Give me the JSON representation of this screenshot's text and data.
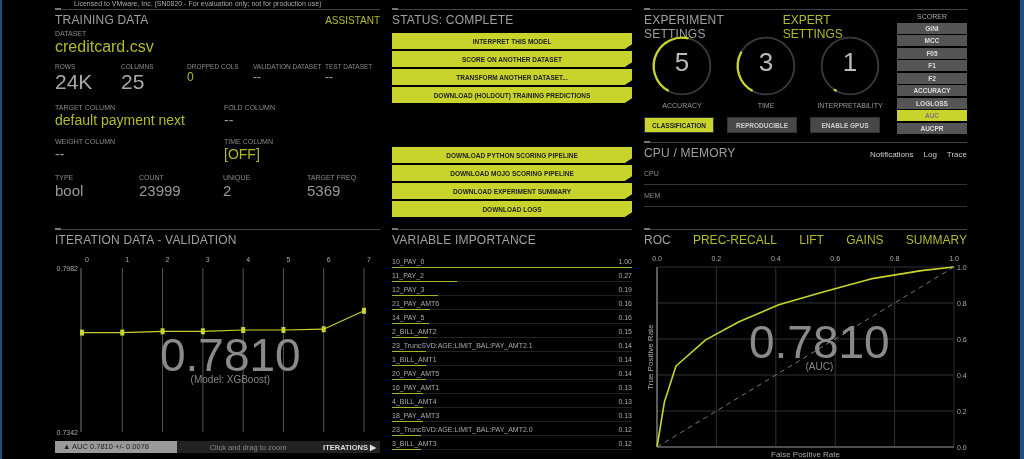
{
  "license_notice": "Licensed to VMware, Inc. (SN0820 - For evaluation only; not for production use)",
  "training_data": {
    "title": "TRAINING DATA",
    "assistant": "ASSISTANT",
    "dataset": {
      "label": "DATASET",
      "value": "creditcard.csv"
    },
    "stats": [
      {
        "label": "ROWS",
        "value": "24K",
        "highlight": false
      },
      {
        "label": "COLUMNS",
        "value": "25",
        "highlight": false
      },
      {
        "label": "DROPPED COLS",
        "value": "0",
        "highlight": true
      },
      {
        "label": "VALIDATION DATASET",
        "value": "--",
        "highlight": false
      },
      {
        "label": "TEST DATASET",
        "value": "--",
        "highlight": false
      }
    ],
    "columns": [
      {
        "label": "TARGET COLUMN",
        "value": "default payment next",
        "highlight": true
      },
      {
        "label": "FOLD COLUMN",
        "value": "--",
        "highlight": false
      },
      {
        "label": "WEIGHT COLUMN",
        "value": "--",
        "highlight": false
      },
      {
        "label": "TIME COLUMN",
        "value": "[OFF]",
        "highlight": true
      }
    ],
    "target": [
      {
        "label": "TYPE",
        "value": "bool"
      },
      {
        "label": "COUNT",
        "value": "23999"
      },
      {
        "label": "UNIQUE",
        "value": "2"
      },
      {
        "label": "TARGET FREQ",
        "value": "5369"
      }
    ]
  },
  "status": {
    "title": "STATUS: COMPLETE",
    "actions": [
      "INTERPRET THIS MODEL",
      "SCORE ON ANOTHER DATASET",
      "TRANSFORM ANOTHER DATASET...",
      "DOWNLOAD (HOLDOUT) TRAINING PREDICTIONS"
    ],
    "downloads": [
      "DOWNLOAD PYTHON SCORING PIPELINE",
      "DOWNLOAD MOJO SCORING PIPELINE",
      "DOWNLOAD EXPERIMENT SUMMARY",
      "DOWNLOAD LOGS"
    ]
  },
  "experiment_settings": {
    "title": "EXPERIMENT SETTINGS",
    "expert": "EXPERT SETTINGS",
    "dials": [
      {
        "value": "5",
        "label": "ACCURACY",
        "level": 0.5
      },
      {
        "value": "3",
        "label": "TIME",
        "level": 0.28
      },
      {
        "value": "1",
        "label": "INTERPRETABILITY",
        "level": 0.02
      }
    ],
    "toggles": [
      {
        "label": "CLASSIFICATION",
        "on": true
      },
      {
        "label": "REPRODUCIBLE",
        "on": false
      },
      {
        "label": "ENABLE GPUS",
        "on": false
      }
    ],
    "scorer": {
      "label": "SCORER",
      "options": [
        {
          "label": "GINI",
          "selected": false
        },
        {
          "label": "MCC",
          "selected": false
        },
        {
          "label": "F05",
          "selected": false
        },
        {
          "label": "F1",
          "selected": false
        },
        {
          "label": "F2",
          "selected": false
        },
        {
          "label": "ACCURACY",
          "selected": false
        },
        {
          "label": "LOGLOSS",
          "selected": false
        },
        {
          "label": "AUC",
          "selected": true
        },
        {
          "label": "AUCPR",
          "selected": false
        }
      ]
    }
  },
  "cpu_memory": {
    "title": "CPU / MEMORY",
    "links": [
      "Notifications",
      "Log",
      "Trace"
    ],
    "rows": [
      "CPU",
      "MEM"
    ]
  },
  "iteration_data": {
    "title": "ITERATION DATA - VALIDATION",
    "score": "0.7810",
    "model": "(Model: XGBoost)",
    "chart_data": {
      "type": "line",
      "categories": [
        "0",
        "1",
        "2",
        "3",
        "4",
        "5",
        "6",
        "7"
      ],
      "series": [
        {
          "color": "#c8d42c",
          "marker": "square",
          "values": [
            0.773,
            0.773,
            0.7735,
            0.7735,
            0.774,
            0.774,
            0.7743,
            0.7815
          ]
        }
      ],
      "ylim": [
        0.7342,
        0.7982
      ],
      "yticks": [
        {
          "value": 0.7342,
          "label": "0.7342"
        },
        {
          "value": 0.7982,
          "label": "0.7982"
        }
      ]
    },
    "summary": "▲ AUC 0.7810 +/- 0.0078",
    "hint": "Click and drag to zoom",
    "iterations": "ITERATIONS ▶"
  },
  "variable_importance": {
    "title": "VARIABLE IMPORTANCE",
    "rows": [
      {
        "name": "10_PAY_0",
        "value": "1.00",
        "level": 1.0
      },
      {
        "name": "11_PAY_2",
        "value": "0.27",
        "level": 0.27
      },
      {
        "name": "12_PAY_3",
        "value": "0.19",
        "level": 0.19
      },
      {
        "name": "21_PAY_AMT6",
        "value": "0.16",
        "level": 0.16
      },
      {
        "name": "14_PAY_5",
        "value": "0.16",
        "level": 0.155
      },
      {
        "name": "2_BILL_AMT2",
        "value": "0.15",
        "level": 0.15
      },
      {
        "name": "23_TruncSVD:AGE:LIMIT_BAL:PAY_AMT2.1",
        "value": "0.14",
        "level": 0.14
      },
      {
        "name": "1_BILL_AMT1",
        "value": "0.14",
        "level": 0.14
      },
      {
        "name": "20_PAY_AMT5",
        "value": "0.14",
        "level": 0.14
      },
      {
        "name": "16_PAY_AMT1",
        "value": "0.13",
        "level": 0.13
      },
      {
        "name": "4_BILL_AMT4",
        "value": "0.13",
        "level": 0.13
      },
      {
        "name": "18_PAY_AMT3",
        "value": "0.13",
        "level": 0.13
      },
      {
        "name": "23_TruncSVD:AGE:LIMIT_BAL:PAY_AMT2.0",
        "value": "0.12",
        "level": 0.12
      },
      {
        "name": "3_BILL_AMT3",
        "value": "0.12",
        "level": 0.12
      }
    ]
  },
  "roc": {
    "tabs": [
      {
        "label": "ROC",
        "selected": true
      },
      {
        "label": "PREC-RECALL",
        "selected": false
      },
      {
        "label": "LIFT",
        "selected": false
      },
      {
        "label": "GAINS",
        "selected": false
      },
      {
        "label": "SUMMARY",
        "selected": false
      }
    ],
    "score": "0.7810",
    "score_label": "(AUC)",
    "chart_data": {
      "type": "line",
      "xlabel": "False Positive Rate",
      "ylabel": "True Positive Rate",
      "x": [
        0,
        0.025,
        0.064,
        0.164,
        0.276,
        0.41,
        0.556,
        0.72,
        0.89,
        1.0
      ],
      "grid": true,
      "series": [
        {
          "color": "#c8d42c",
          "line_style": "solid",
          "values": [
            0,
            0.25,
            0.45,
            0.595,
            0.696,
            0.79,
            0.86,
            0.934,
            0.98,
            1.0
          ]
        },
        {
          "color": "#777777",
          "line_style": "dashed",
          "values": [
            0,
            0.025,
            0.064,
            0.164,
            0.276,
            0.41,
            0.556,
            0.72,
            0.89,
            1.0
          ]
        }
      ],
      "xlim": [
        0,
        1
      ],
      "ylim": [
        0,
        1
      ],
      "xticks": [
        {
          "value": 0,
          "label": "0.0"
        },
        {
          "value": 0.2,
          "label": "0.2"
        },
        {
          "value": 0.4,
          "label": "0.4"
        },
        {
          "value": 0.6,
          "label": "0.6"
        },
        {
          "value": 0.8,
          "label": "0.8"
        },
        {
          "value": 1,
          "label": "1.0"
        }
      ],
      "yticks": [
        {
          "value": 0,
          "label": "0.0"
        },
        {
          "value": 0.2,
          "label": "0.2"
        },
        {
          "value": 0.4,
          "label": "0.4"
        },
        {
          "value": 0.6,
          "label": "0.6"
        },
        {
          "value": 0.8,
          "label": "0.8"
        },
        {
          "value": 1,
          "label": "1.0"
        }
      ]
    }
  }
}
